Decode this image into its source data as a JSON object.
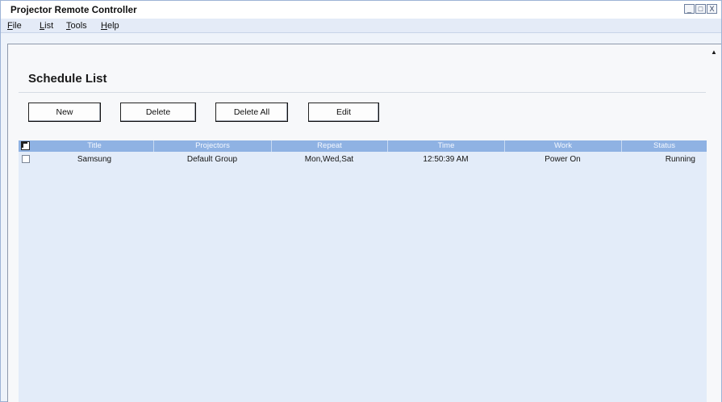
{
  "window": {
    "title": "Projector Remote Controller",
    "controls": [
      "_",
      "□",
      "X"
    ]
  },
  "menu": [
    {
      "label": "File",
      "key": "F",
      "rest": "ile"
    },
    {
      "label": "List",
      "key": "L",
      "rest": "ist"
    },
    {
      "label": "Tools",
      "key": "T",
      "rest": "ools"
    },
    {
      "label": "Help",
      "key": "H",
      "rest": "elp"
    }
  ],
  "panel": {
    "title": "Schedule List"
  },
  "toolbar": {
    "new_label": "New",
    "delete_label": "Delete",
    "delete_all_label": "Delete All",
    "edit_label": "Edit"
  },
  "table": {
    "columns": [
      "Title",
      "Projectors",
      "Repeat",
      "Time",
      "Work",
      "Status"
    ],
    "rows": [
      {
        "checked": false,
        "title": "Samsung",
        "projectors": "Default Group",
        "repeat": "Mon,Wed,Sat",
        "time": "12:50:39 AM",
        "work": "Power On",
        "status": "Running"
      }
    ]
  },
  "icons": {
    "scroll_up": "scroll-up-arrow-icon"
  },
  "colors": {
    "header": "#8fb2e3",
    "table_bg": "#e3ecf9",
    "menubar": "#e4ebf7"
  }
}
